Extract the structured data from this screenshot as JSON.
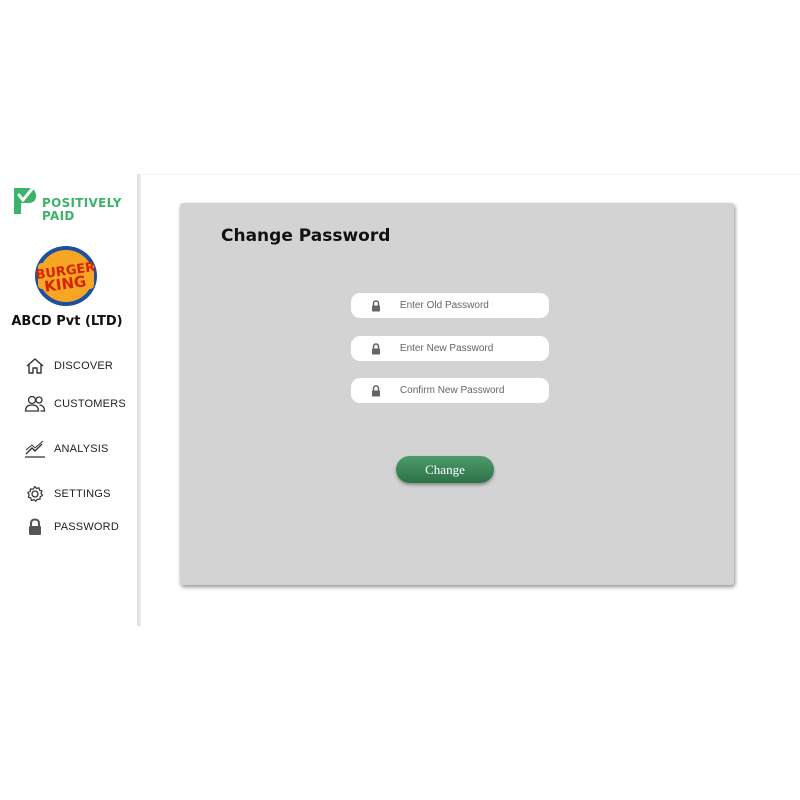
{
  "brand": {
    "name_line1": "POSITIVELY",
    "name_line2": "PAID",
    "color": "#3bb36a"
  },
  "company": {
    "logo_line1": "BURGER",
    "logo_line2": "KING",
    "name": "ABCD Pvt (LTD)"
  },
  "sidebar": {
    "items": [
      {
        "label": "DISCOVER",
        "icon": "home-icon"
      },
      {
        "label": "CUSTOMERS",
        "icon": "users-icon"
      },
      {
        "label": "ANALYSIS",
        "icon": "trend-chart-icon"
      },
      {
        "label": "SETTINGS",
        "icon": "gear-icon"
      },
      {
        "label": "PASSWORD",
        "icon": "lock-icon"
      }
    ]
  },
  "main": {
    "title": "Change Password",
    "fields": [
      {
        "placeholder": "Enter Old Password",
        "icon": "lock-icon"
      },
      {
        "placeholder": "Enter New Password",
        "icon": "lock-icon"
      },
      {
        "placeholder": "Confirm New Password",
        "icon": "lock-icon"
      }
    ],
    "submit_label": "Change",
    "button_color": "#3f8a5c",
    "panel_color": "#d3d3d3"
  }
}
